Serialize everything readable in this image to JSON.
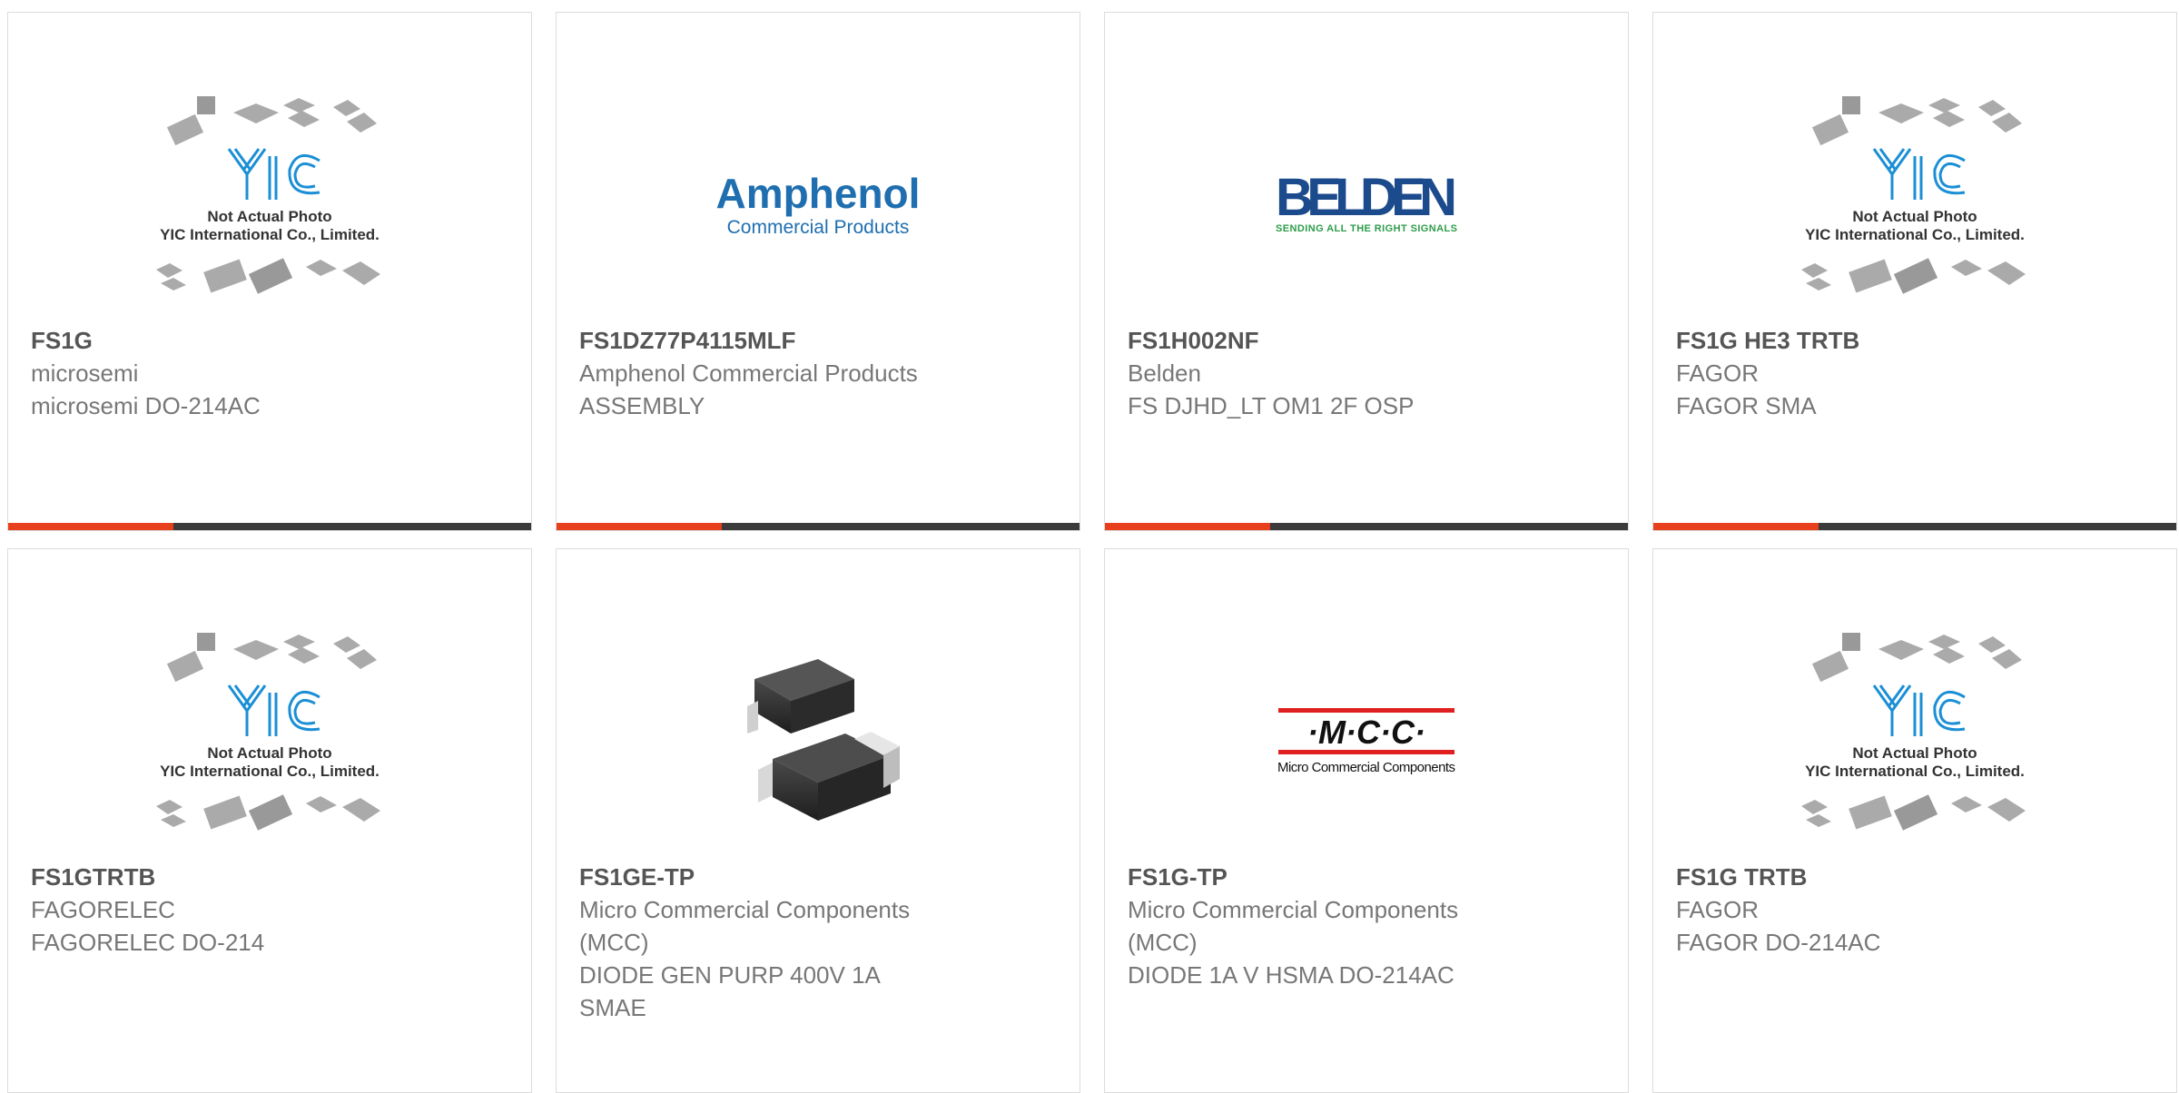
{
  "products": [
    {
      "part_number": "FS1G",
      "manufacturer": "microsemi",
      "description": "microsemi DO-214AC",
      "image": "yic-placeholder-icon",
      "placeholder": {
        "logo": "YIC",
        "line1": "Not Actual Photo",
        "line2": "YIC International Co., Limited."
      }
    },
    {
      "part_number": "FS1DZ77P4115MLF",
      "manufacturer": "Amphenol Commercial Products",
      "description": "ASSEMBLY",
      "image": "amphenol-logo",
      "logo": {
        "name": "Amphenol",
        "tagline": "Commercial Products",
        "color": "#1f6fb0"
      }
    },
    {
      "part_number": "FS1H002NF",
      "manufacturer": "Belden",
      "description": "FS DJHD_LT OM1 2F OSP",
      "image": "belden-logo",
      "logo": {
        "name": "BELDEN",
        "tagline": "SENDING ALL THE RIGHT SIGNALS",
        "color": "#1b4b8c",
        "tagline_color": "#2e9d4a"
      }
    },
    {
      "part_number": "FS1G HE3 TRTB",
      "manufacturer": "FAGOR",
      "description": "FAGOR SMA",
      "image": "yic-placeholder-icon",
      "placeholder": {
        "logo": "YIC",
        "line1": "Not Actual Photo",
        "line2": "YIC International Co., Limited."
      }
    },
    {
      "part_number": "FS1GTRTB",
      "manufacturer": "FAGORELEC",
      "description": "FAGORELEC DO-214",
      "image": "yic-placeholder-icon",
      "placeholder": {
        "logo": "YIC",
        "line1": "Not Actual Photo",
        "line2": "YIC International Co., Limited."
      }
    },
    {
      "part_number": "FS1GE-TP",
      "manufacturer": "Micro Commercial Components (MCC)",
      "description": "DIODE GEN PURP 400V 1A SMAE",
      "image": "smd-diode-photo"
    },
    {
      "part_number": "FS1G-TP",
      "manufacturer": "Micro Commercial Components (MCC)",
      "description": "DIODE 1A V HSMA DO-214AC",
      "image": "mcc-logo",
      "logo": {
        "name": "·M·C·C·",
        "tagline": "Micro Commercial Components",
        "color": "#e02020"
      }
    },
    {
      "part_number": "FS1G TRTB",
      "manufacturer": "FAGOR",
      "description": "FAGOR DO-214AC",
      "image": "yic-placeholder-icon",
      "placeholder": {
        "logo": "YIC",
        "line1": "Not Actual Photo",
        "line2": "YIC International Co., Limited."
      }
    }
  ],
  "colors": {
    "accent": "#e8401c",
    "bar": "#3b3b3b",
    "card_border": "#dcdcdc",
    "yic_blue": "#1b8fd6"
  }
}
